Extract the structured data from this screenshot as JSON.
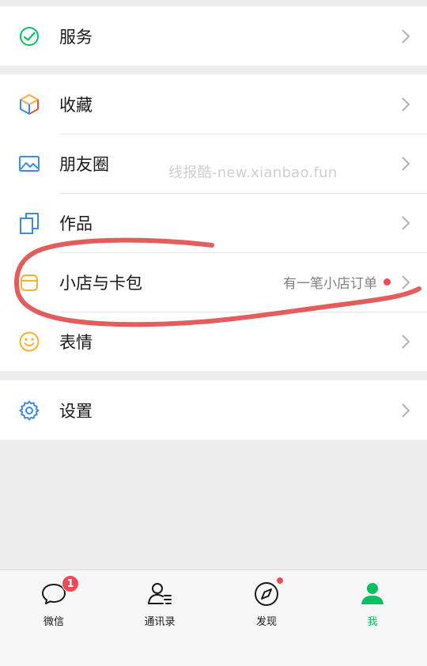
{
  "menu": {
    "services": {
      "label": "服务",
      "icon": "services-check-icon"
    },
    "favorites": {
      "label": "收藏",
      "icon": "cube-icon"
    },
    "moments": {
      "label": "朋友圈",
      "icon": "image-icon"
    },
    "works": {
      "label": "作品",
      "icon": "stacked-cards-icon"
    },
    "shop": {
      "label": "小店与卡包",
      "icon": "wallet-card-icon",
      "extra": "有一笔小店订单"
    },
    "stickers": {
      "label": "表情",
      "icon": "smile-icon"
    },
    "settings": {
      "label": "设置",
      "icon": "gear-icon"
    }
  },
  "watermark": "线报酷-new.xianbao.fun",
  "tabbar": {
    "tabs": [
      {
        "label": "微信",
        "icon": "chat-bubble-icon",
        "badge": "1"
      },
      {
        "label": "通讯录",
        "icon": "contacts-icon"
      },
      {
        "label": "发现",
        "icon": "compass-icon"
      },
      {
        "label": "我",
        "icon": "person-icon"
      }
    ]
  },
  "colors": {
    "accent_green": "#07c160",
    "badge_red": "#f04b55",
    "annotation_red": "#e05050",
    "background": "#ededed"
  }
}
